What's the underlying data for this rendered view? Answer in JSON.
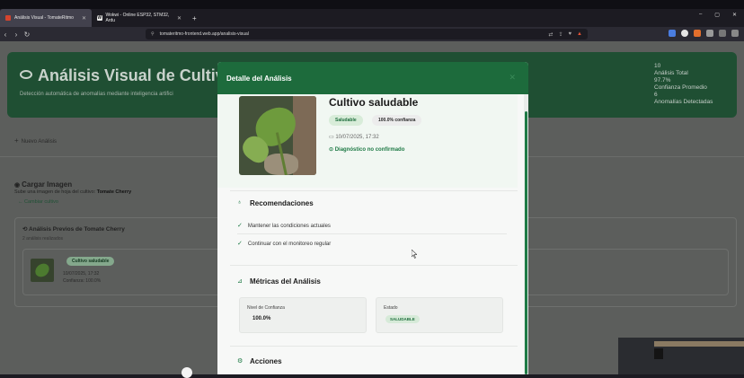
{
  "browser": {
    "tabs": [
      {
        "label": "Análisis Visual - TomateRitmo",
        "active": true
      },
      {
        "label": "Wokwi - Online ESP32, STM32, Ardu",
        "active": false
      }
    ],
    "url": "tomateritmo-frontend.web.app/analisis-visual",
    "win_minimize": "–",
    "win_maximize": "▢",
    "win_close": "✕"
  },
  "hero": {
    "title": "Análisis Visual de Cultiv",
    "subtitle": "Detección automática de anomalías mediante inteligencia artifici",
    "stats": [
      {
        "value": "10",
        "label": "Análisis Total"
      },
      {
        "value": "97.7%",
        "label": "Confianza Promedio"
      },
      {
        "value": "6",
        "label": "Anomalías Detectadas"
      }
    ]
  },
  "page": {
    "new_analysis": "Nuevo Análisis",
    "upload_title": "Cargar Imagen",
    "upload_sub_prefix": "Sube una imagen de hoja del cultivo:",
    "crop_name": "Tomate Cherry",
    "change_crop": "Cambiar cultivo",
    "prev_title": "Análisis Previos de Tomate Cherry",
    "prev_count": "2 análisis realizados",
    "prev_item": {
      "badge": "Cultivo saludable",
      "date": "10/07/2025, 17:32",
      "confidence": "Confianza: 100.0%"
    }
  },
  "modal": {
    "title": "Detalle del Análisis",
    "close": "✕",
    "status_title": "Cultivo saludable",
    "status_pill": "Saludable",
    "confidence_pill": "100.0% confianza",
    "date": "10/07/2025, 17:32",
    "diagnosis": "Diagnóstico no confirmado",
    "recommendations_title": "Recomendaciones",
    "recommendations": [
      "Mantener las condiciones actuales",
      "Continuar con el monitoreo regular"
    ],
    "metrics_title": "Métricas del Análisis",
    "metrics": {
      "confidence_label": "Nivel de Confianza",
      "confidence_value": "100.0%",
      "state_label": "Estado",
      "state_value": "SALUDABLE"
    },
    "actions_title": "Acciones"
  },
  "colors": {
    "primary_green": "#1d6b3c",
    "accent_green": "#1e7a45",
    "overlay_dim": "#5c5e5c"
  }
}
